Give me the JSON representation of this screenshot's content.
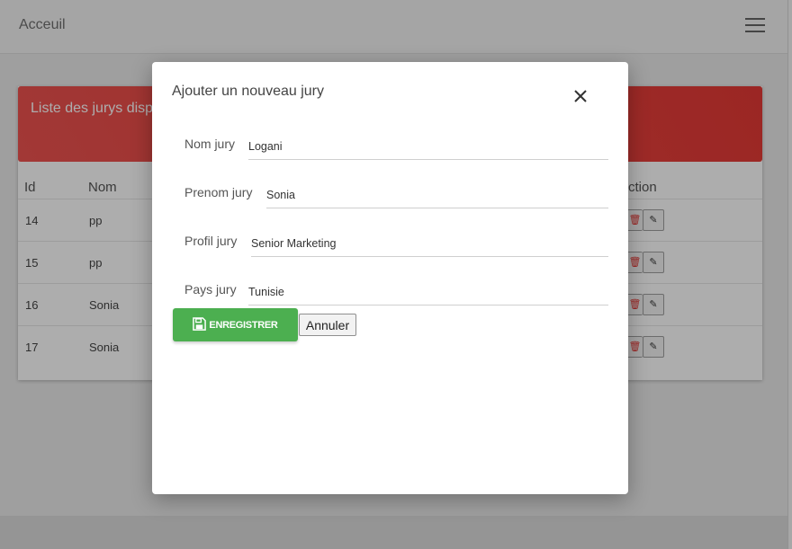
{
  "navbar": {
    "brand": "Acceuil",
    "menu_icon": "hamburger-icon"
  },
  "card": {
    "title": "Liste des jurys disp",
    "columns": {
      "id": "Id",
      "nom": "Nom",
      "action": "ction"
    },
    "rows": [
      {
        "id": "14",
        "nom": "pp"
      },
      {
        "id": "15",
        "nom": "pp"
      },
      {
        "id": "16",
        "nom": "Sonia"
      },
      {
        "id": "17",
        "nom": "Sonia"
      }
    ],
    "icons": {
      "delete": "trash-icon",
      "edit": "edit-icon"
    }
  },
  "modal": {
    "title": "Ajouter un nouveau jury",
    "close_icon": "close-icon",
    "fields": {
      "nom": {
        "label": "Nom jury",
        "value": "Logani"
      },
      "prenom": {
        "label": "Prenom jury",
        "value": "Sonia"
      },
      "profil": {
        "label": "Profil jury",
        "value": "Senior Marketing"
      },
      "pays": {
        "label": "Pays jury",
        "value": "Tunisie"
      }
    },
    "save_label": "ENREGISTRER",
    "save_icon": "floppy-disk-icon",
    "cancel_label": "Annuler"
  },
  "colors": {
    "header_red": "#e53935",
    "save_green": "#4caf50",
    "delete_red": "#e53935"
  }
}
